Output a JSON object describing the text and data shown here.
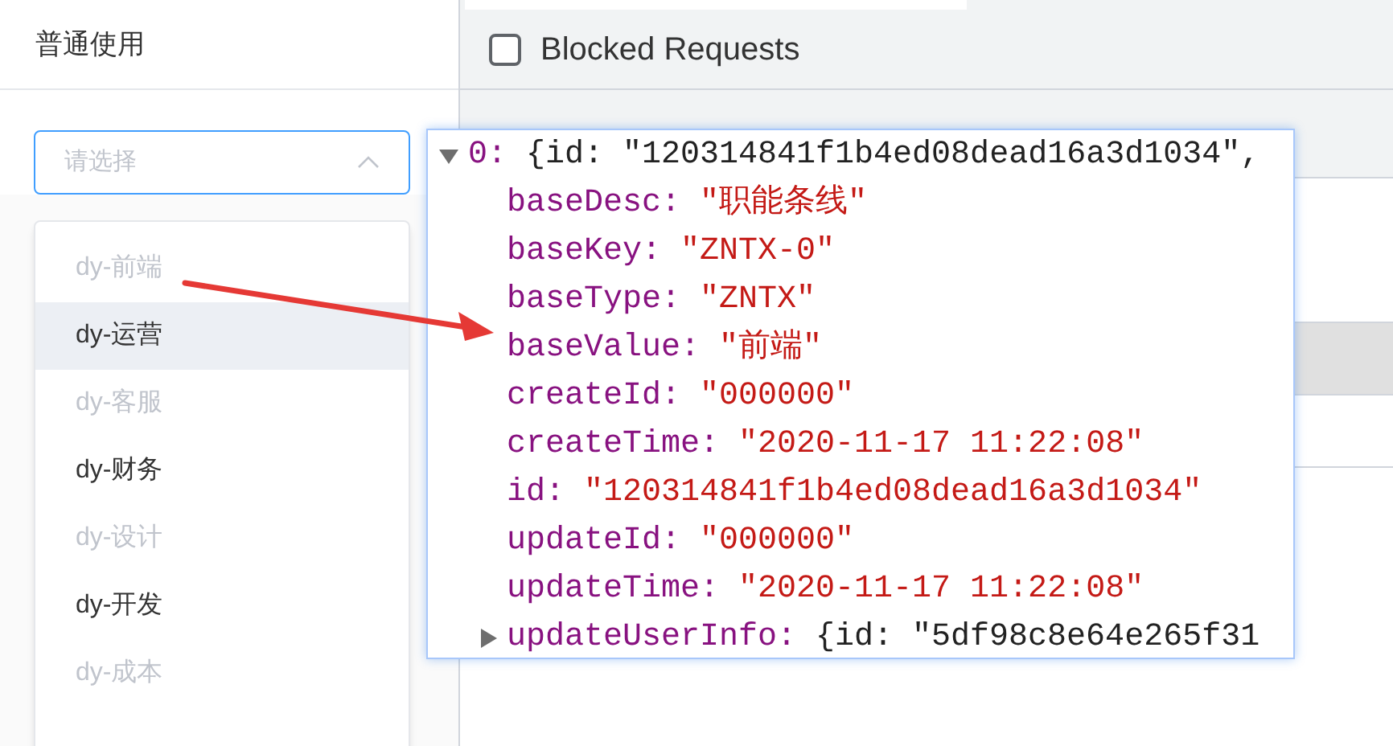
{
  "left_panel": {
    "title": "普通使用",
    "select": {
      "placeholder": "请选择",
      "expanded": true
    },
    "options": [
      {
        "label": "dy-前端",
        "disabled": true,
        "hovered": false
      },
      {
        "label": "dy-运营",
        "disabled": false,
        "hovered": true
      },
      {
        "label": "dy-客服",
        "disabled": true,
        "hovered": false
      },
      {
        "label": "dy-财务",
        "disabled": false,
        "hovered": false
      },
      {
        "label": "dy-设计",
        "disabled": true,
        "hovered": false
      },
      {
        "label": "dy-开发",
        "disabled": false,
        "hovered": false
      },
      {
        "label": "dy-成本",
        "disabled": true,
        "hovered": false
      }
    ]
  },
  "devtools": {
    "filter_checkbox": {
      "label": "Blocked Requests",
      "checked": false
    },
    "object_preview": {
      "index": "0:",
      "expanded": true,
      "summary": "{id: \"120314841f1b4ed08dead16a3d1034\",",
      "properties": [
        {
          "kind": "string",
          "key": "baseDesc:",
          "value": "\"职能条线\""
        },
        {
          "kind": "string",
          "key": "baseKey:",
          "value": "\"ZNTX-0\""
        },
        {
          "kind": "string",
          "key": "baseType:",
          "value": "\"ZNTX\""
        },
        {
          "kind": "string",
          "key": "baseValue:",
          "value": "\"前端\""
        },
        {
          "kind": "string",
          "key": "createId:",
          "value": "\"000000\""
        },
        {
          "kind": "string",
          "key": "createTime:",
          "value": "\"2020-11-17 11:22:08\""
        },
        {
          "kind": "string",
          "key": "id:",
          "value": "\"120314841f1b4ed08dead16a3d1034\""
        },
        {
          "kind": "string",
          "key": "updateId:",
          "value": "\"000000\""
        },
        {
          "kind": "string",
          "key": "updateTime:",
          "value": "\"2020-11-17 11:22:08\""
        },
        {
          "kind": "object",
          "key": "updateUserInfo:",
          "value": "{id: \"5df98c8e64e265f31",
          "expanded": false
        }
      ]
    }
  }
}
